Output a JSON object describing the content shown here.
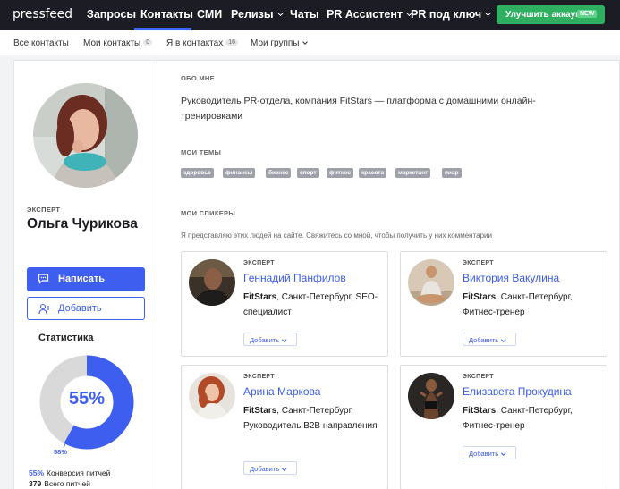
{
  "header": {
    "logo": "pressfeed",
    "nav": [
      {
        "label": "Запросы",
        "dropdown": false
      },
      {
        "label": "Контакты",
        "dropdown": false,
        "active": true
      },
      {
        "label": "СМИ",
        "dropdown": false
      },
      {
        "label": "Релизы",
        "dropdown": true
      },
      {
        "label": "Чаты",
        "dropdown": false
      },
      {
        "label": "PR Ассистент",
        "dropdown": true
      },
      {
        "label": "PR под ключ",
        "dropdown": true
      }
    ],
    "upgrade_label": "Улучшить аккаунт",
    "upgrade_badge": "NEW"
  },
  "subnav": {
    "items": [
      {
        "label": "Все контакты",
        "count": null
      },
      {
        "label": "Мои контакты",
        "count": "0"
      },
      {
        "label": "Я в контактах",
        "count": "16"
      },
      {
        "label": "Мои группы",
        "count": null
      }
    ]
  },
  "profile": {
    "role": "ЭКСПЕРТ",
    "name": "Ольга Чурикова",
    "write_label": "Написать",
    "add_label": "Добавить"
  },
  "stats": {
    "title": "Статистика",
    "donut_percent": "55%",
    "donut_fraction": 0.58,
    "donut_small_label": "58%",
    "rows": [
      {
        "value": "55%",
        "label": "Конверсия питчей"
      },
      {
        "value": "379",
        "label": "Всего питчей"
      }
    ]
  },
  "about": {
    "heading": "ОБО МНЕ",
    "text": "Руководитель PR-отдела, компания FitStars — платформа с домашними онлайн-тренировками"
  },
  "topics": {
    "heading": "МОИ ТЕМЫ",
    "tags": [
      "здоровье",
      "финансы",
      "бизнес",
      "спорт",
      "фитнес",
      "красота",
      "маркетинг",
      "пиар"
    ]
  },
  "speakers": {
    "heading": "МОИ СПИКЕРЫ",
    "note": "Я представляю этих людей на сайте. Свяжитесь со мной, чтобы получить у них комментарии",
    "add_label": "Добавить",
    "cards": [
      {
        "role": "ЭКСПЕРТ",
        "name": "Геннадий Панфилов",
        "company": "FitStars",
        "details": ", Санкт-Петербург, SEO-специалист"
      },
      {
        "role": "ЭКСПЕРТ",
        "name": "Виктория Вакулина",
        "company": "FitStars",
        "details": ", Санкт-Петербург, Фитнес-тренер"
      },
      {
        "role": "ЭКСПЕРТ",
        "name": "Арина Маркова",
        "company": "FitStars",
        "details": ", Санкт-Петербург, Руководитель B2B направления"
      },
      {
        "role": "ЭКСПЕРТ",
        "name": "Елизавета Прокудина",
        "company": "FitStars",
        "details": ", Санкт-Петербург, Фитнес-тренер"
      }
    ]
  },
  "colors": {
    "accent": "#3e5ef0",
    "topbar": "#1c1c24",
    "upgrade": "#2eb060",
    "tag": "#9ea1a8",
    "donut_track": "#d9d9d9"
  }
}
